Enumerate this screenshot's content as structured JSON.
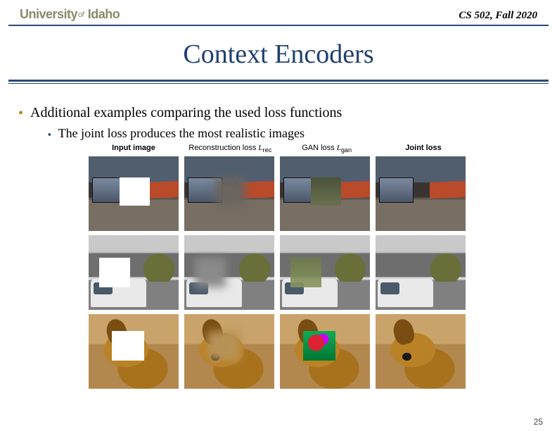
{
  "header": {
    "logo_prefix": "University",
    "logo_of": "of",
    "logo_suffix": " Idaho",
    "course": "CS 502, Fall 2020"
  },
  "title": "Context Encoders",
  "bullets": {
    "main": "Additional examples comparing the used loss functions",
    "sub": "The joint loss produces the most realistic images"
  },
  "columns": {
    "c1": "Input image",
    "c2_text": "Reconstruction loss ",
    "c2_sym": "L",
    "c2_sub": "rec",
    "c3_text": "GAN loss ",
    "c3_sym": "L",
    "c3_sub": "gan",
    "c4": "Joint loss"
  },
  "slide_number": "25"
}
